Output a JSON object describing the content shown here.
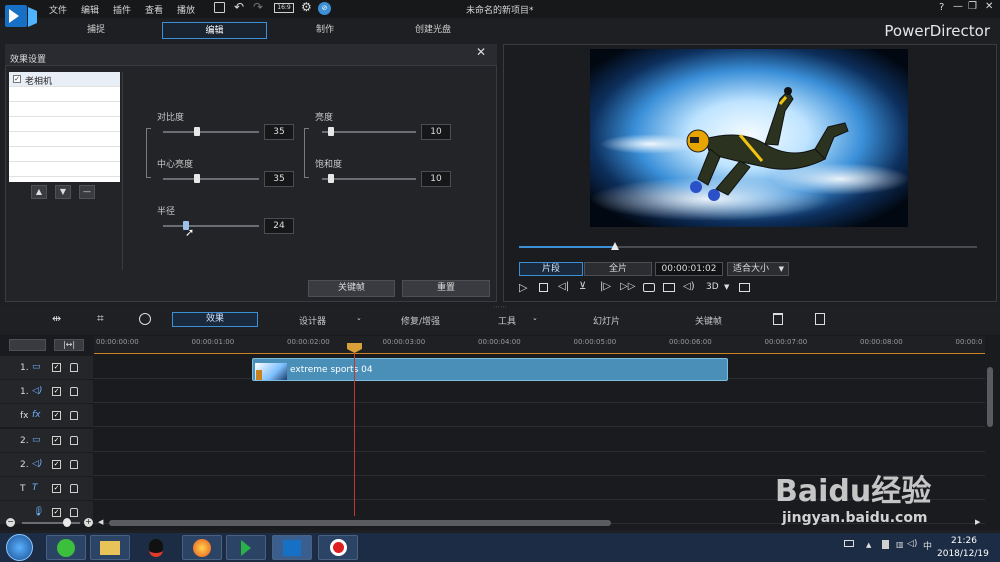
{
  "window": {
    "title": "未命名的新项目*",
    "menu": [
      "文件",
      "编辑",
      "插件",
      "查看",
      "播放"
    ],
    "controls": [
      "?",
      "—",
      "❐",
      "✕"
    ]
  },
  "modes": {
    "tabs": [
      "捕捉",
      "编辑",
      "制作",
      "创建光盘"
    ],
    "active": "编辑",
    "brand": "PowerDirector"
  },
  "effect_panel": {
    "title": "效果设置",
    "effects": [
      {
        "name": "老相机",
        "checked": true
      }
    ],
    "sliders": [
      {
        "label": "对比度",
        "value": "35",
        "level": 0.35
      },
      {
        "label": "亮度",
        "value": "10",
        "level": 0.1
      },
      {
        "label": "中心亮度",
        "value": "35",
        "level": 0.35
      },
      {
        "label": "饱和度",
        "value": "10",
        "level": 0.1
      },
      {
        "label": "半径",
        "value": "24",
        "level": 0.24
      }
    ],
    "buttons": {
      "keyframe": "关键帧",
      "reset": "重置"
    }
  },
  "preview": {
    "mode_clip": "片段",
    "mode_movie": "全片",
    "timecode": "00:00:01:02",
    "fit": "适合大小",
    "threed": "3D",
    "scrub_progress": 0.21
  },
  "timeline_toolbar": {
    "effects": "效果",
    "designer": "设计器",
    "fix": "修复/增强",
    "tools": "工具",
    "slideshow": "幻灯片",
    "keyframe": "关键帧"
  },
  "ruler": [
    "00:00:00:00",
    "00:00:01:00",
    "00:00:02:00",
    "00:00:03:00",
    "00:00:04:00",
    "00:00:05:00",
    "00:00:06:00",
    "00:00:07:00",
    "00:00:08:00",
    "00:00:0"
  ],
  "tracks": [
    {
      "label": "1.",
      "kind": "video"
    },
    {
      "label": "1.",
      "kind": "audio"
    },
    {
      "label": "fx",
      "kind": "fx"
    },
    {
      "label": "2.",
      "kind": "video"
    },
    {
      "label": "2.",
      "kind": "audio"
    },
    {
      "label": "T",
      "kind": "title"
    },
    {
      "label": "",
      "kind": "mic"
    }
  ],
  "clip": {
    "name": "extreme sports 04"
  },
  "taskbar": {
    "time": "21:26",
    "date": "2018/12/19"
  },
  "watermark": {
    "line1": "Baidu经验",
    "line2": "jingyan.baidu.com"
  },
  "colors": {
    "accent": "#3d8fd6",
    "clip": "#4a8fb8",
    "playhead": "#c0392b"
  }
}
